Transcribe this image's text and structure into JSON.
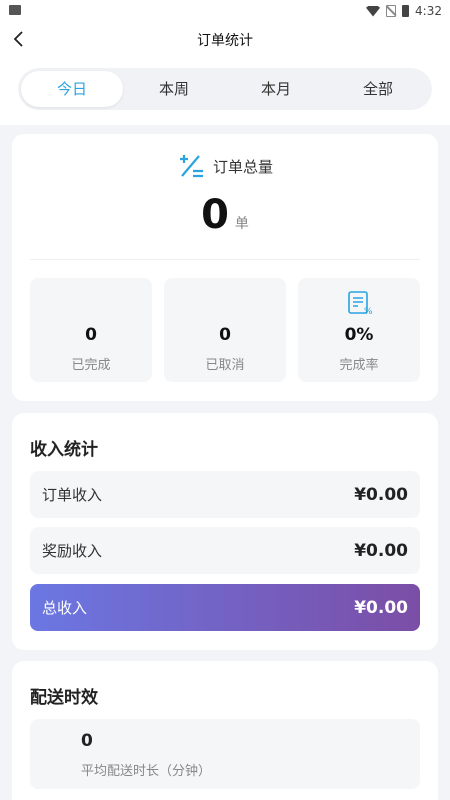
{
  "statusbar": {
    "time": "4:32"
  },
  "header": {
    "title": "订单统计",
    "back_icon": "chevron-left-icon"
  },
  "tabs": [
    {
      "label": "今日",
      "active": true
    },
    {
      "label": "本周",
      "active": false
    },
    {
      "label": "本月",
      "active": false
    },
    {
      "label": "全部",
      "active": false
    }
  ],
  "order_total": {
    "label": "订单总量",
    "value": "0",
    "unit": "单",
    "icon": "plus-minus-icon",
    "accent": "#2aa3e0"
  },
  "stats": [
    {
      "value": "0",
      "label": "已完成"
    },
    {
      "value": "0",
      "label": "已取消"
    },
    {
      "value": "0%",
      "label": "完成率",
      "icon": "document-percent-icon"
    }
  ],
  "income": {
    "title": "收入统计",
    "rows": [
      {
        "label": "订单收入",
        "value": "¥0.00"
      },
      {
        "label": "奖励收入",
        "value": "¥0.00"
      },
      {
        "label": "总收入",
        "value": "¥0.00",
        "highlight": true
      }
    ],
    "gradient": [
      "#6b77e2",
      "#7b4ea6"
    ]
  },
  "delivery": {
    "title": "配送时效",
    "avg_value": "0",
    "avg_label": "平均配送时长（分钟）"
  }
}
